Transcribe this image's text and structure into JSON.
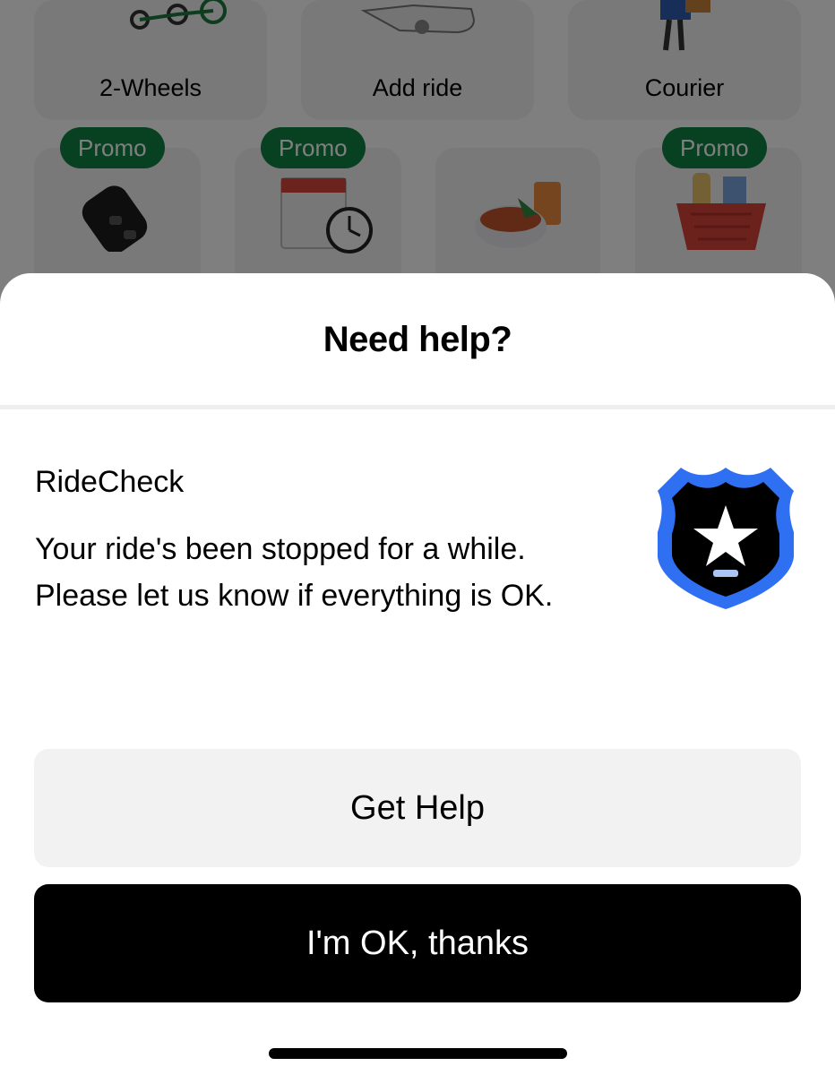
{
  "background": {
    "services_row1": [
      {
        "label": "2-Wheels",
        "icon": "scooter-icon"
      },
      {
        "label": "Add ride",
        "icon": "car-icon"
      },
      {
        "label": "Courier",
        "icon": "courier-icon"
      }
    ],
    "services_row2": [
      {
        "promo": "Promo",
        "icon": "key-fob-icon"
      },
      {
        "promo": "Promo",
        "icon": "calendar-clock-icon"
      },
      {
        "promo": "",
        "icon": "food-bowl-icon"
      },
      {
        "promo": "Promo",
        "icon": "grocery-basket-icon"
      }
    ],
    "promo_color": "#0e8345"
  },
  "sheet": {
    "title": "Need help?",
    "ridecheck": {
      "heading": "RideCheck",
      "body": "Your ride's been stopped for a while. Please let us know if everything is OK.",
      "icon": "shield-star-icon",
      "icon_color": "#2f6ff2"
    },
    "get_help_label": "Get Help",
    "ok_label": "I'm OK, thanks"
  }
}
